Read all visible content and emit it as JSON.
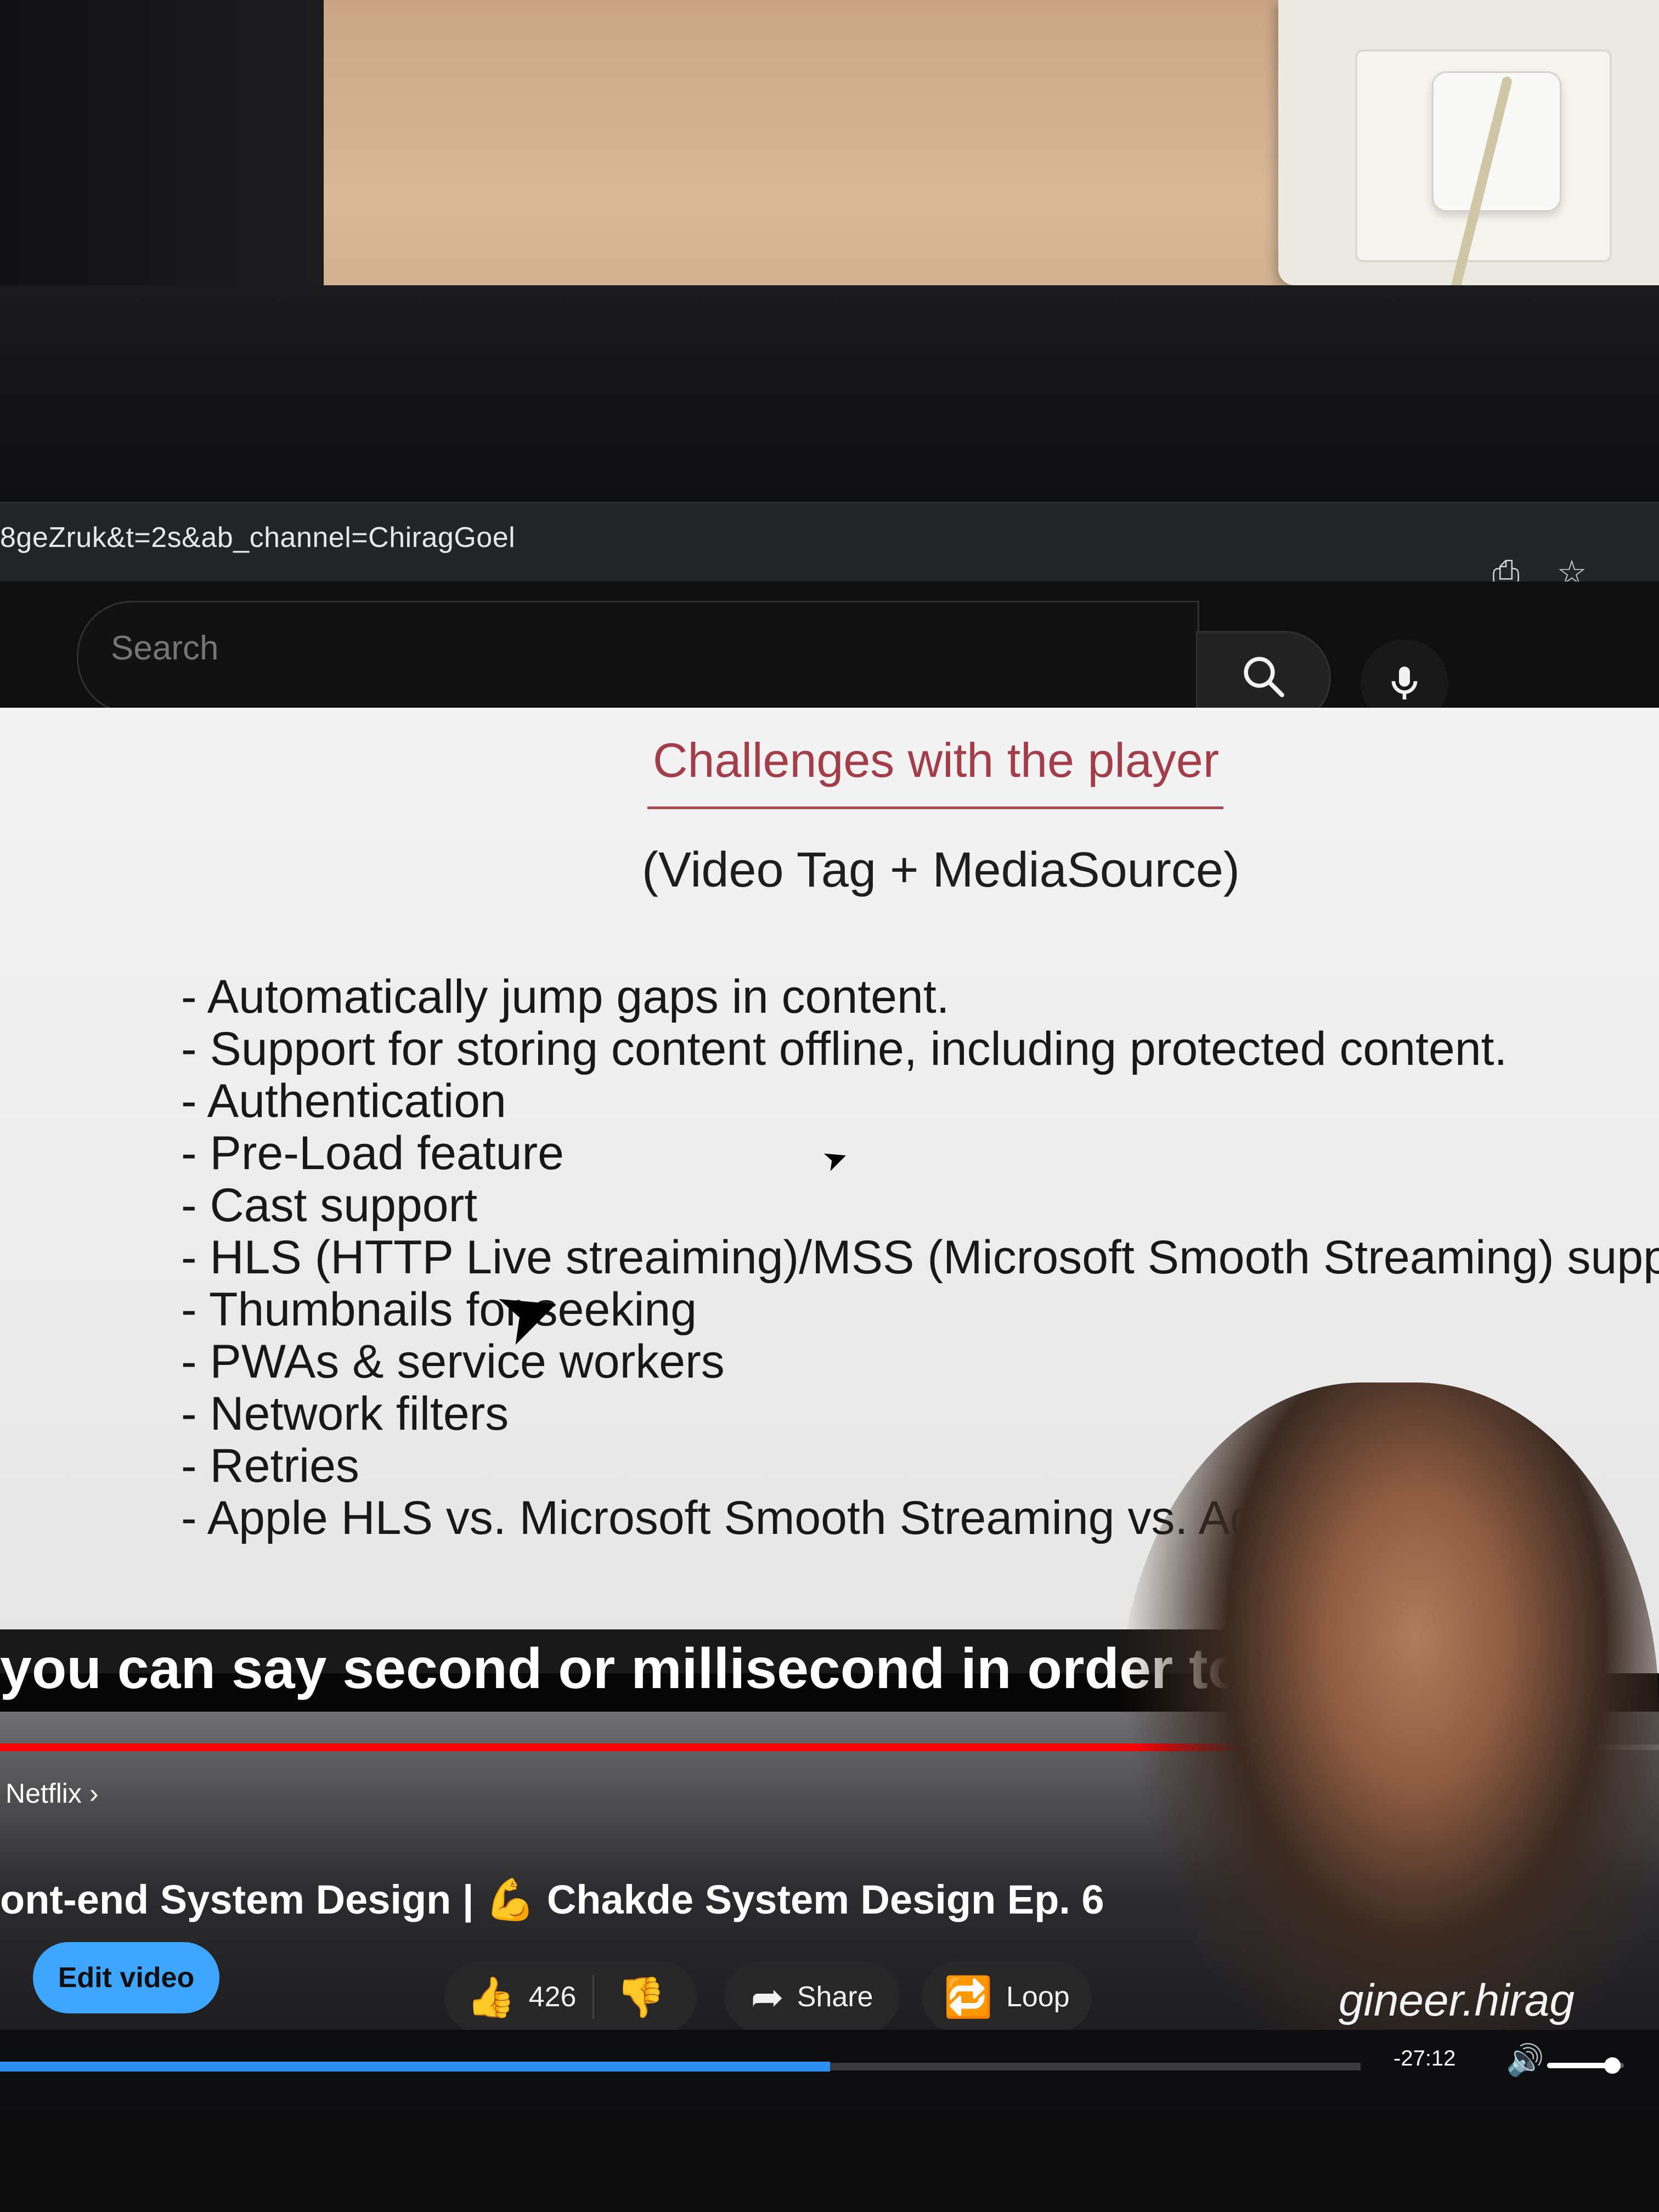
{
  "browser": {
    "url": "8geZruk&t=2s&ab_channel=ChiragGoel",
    "icons": [
      "install-app-icon",
      "bookmark-star-icon"
    ]
  },
  "youtube": {
    "search_placeholder": "Search",
    "icons": [
      "search-icon",
      "microphone-icon"
    ]
  },
  "slide": {
    "title": "Challenges with the player",
    "subtitle": "(Video Tag + MediaSource)",
    "bullets": [
      "- Automatically jump gaps in content.",
      "- Support for storing content offline, including protected content.",
      "- Authentication",
      "- Pre-Load feature",
      "- Cast support",
      "- HLS (HTTP Live streaiming)/MSS (Microsoft Smooth Streaming) supp",
      "- Thumbnails for seeking",
      "- PWAs & service workers",
      "- Network filters",
      "- Retries",
      "- Apple HLS vs. Microsoft Smooth Streaming vs. Adobe"
    ]
  },
  "player": {
    "caption": "you can say second or millisecond in order to load the da",
    "chapter": "Netflix",
    "title": "ont-end System Design | 💪 Chakde System Design Ep. 6",
    "edit_label": "Edit video",
    "like_count": "426",
    "share_label": "Share",
    "loop_label": "Loop",
    "watermark": "gineer.hirag",
    "time_remaining": "-27:12",
    "progress_fraction": 0.61,
    "buffer_red_fraction": 0.775,
    "volume_fraction": 0.85,
    "colors": {
      "accent_blue": "#3ea6ff",
      "progress_red": "#ff0000",
      "title_red": "#a33d49"
    }
  }
}
